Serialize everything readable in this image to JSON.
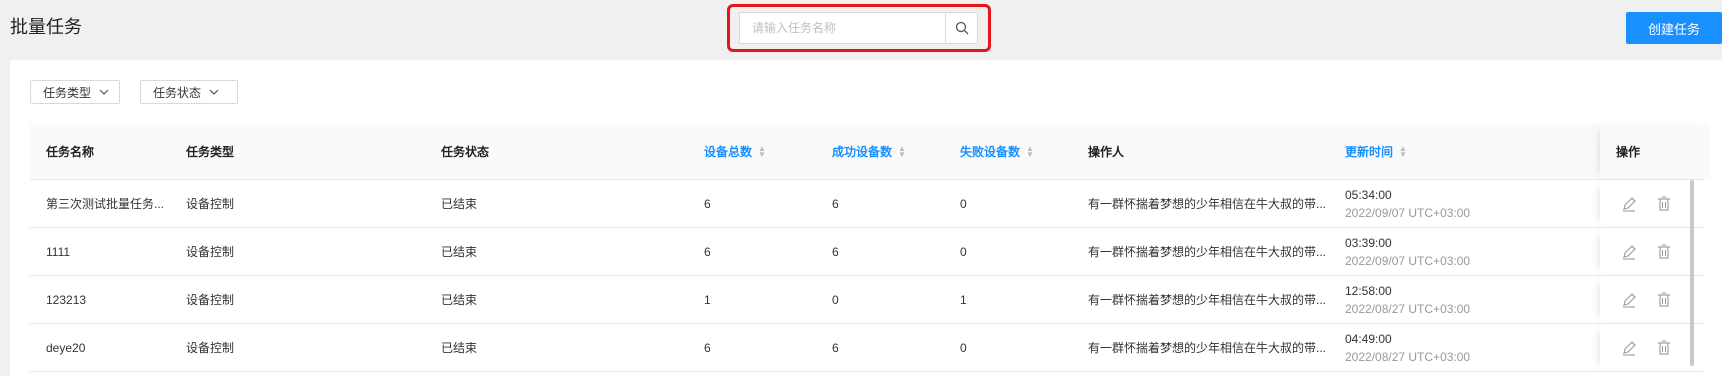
{
  "header": {
    "title": "批量任务",
    "search_placeholder": "请输入任务名称",
    "create_label": "创建任务",
    "accent_color": "#1890ff",
    "highlight_color": "#e6151b"
  },
  "filters": [
    {
      "label": "任务类型",
      "icon": "chevron-down-icon"
    },
    {
      "label": "任务状态",
      "icon": "chevron-down-icon"
    }
  ],
  "table": {
    "columns": {
      "name": "任务名称",
      "type": "任务类型",
      "status": "任务状态",
      "total": "设备总数",
      "success": "成功设备数",
      "fail": "失败设备数",
      "operator": "操作人",
      "updated": "更新时间",
      "actions": "操作"
    },
    "rows": [
      {
        "name": "第三次测试批量任务...",
        "type": "设备控制",
        "status": "已结束",
        "total": "6",
        "success": "6",
        "fail": "0",
        "operator": "有一群怀揣着梦想的少年相信在牛大叔的带...",
        "time": "05:34:00",
        "date": "2022/09/07 UTC+03:00"
      },
      {
        "name": "1111",
        "type": "设备控制",
        "status": "已结束",
        "total": "6",
        "success": "6",
        "fail": "0",
        "operator": "有一群怀揣着梦想的少年相信在牛大叔的带...",
        "time": "03:39:00",
        "date": "2022/09/07 UTC+03:00"
      },
      {
        "name": "123213",
        "type": "设备控制",
        "status": "已结束",
        "total": "1",
        "success": "0",
        "fail": "1",
        "operator": "有一群怀揣着梦想的少年相信在牛大叔的带...",
        "time": "12:58:00",
        "date": "2022/08/27 UTC+03:00"
      },
      {
        "name": "deye20",
        "type": "设备控制",
        "status": "已结束",
        "total": "6",
        "success": "6",
        "fail": "0",
        "operator": "有一群怀揣着梦想的少年相信在牛大叔的带...",
        "time": "04:49:00",
        "date": "2022/08/27 UTC+03:00"
      }
    ]
  }
}
